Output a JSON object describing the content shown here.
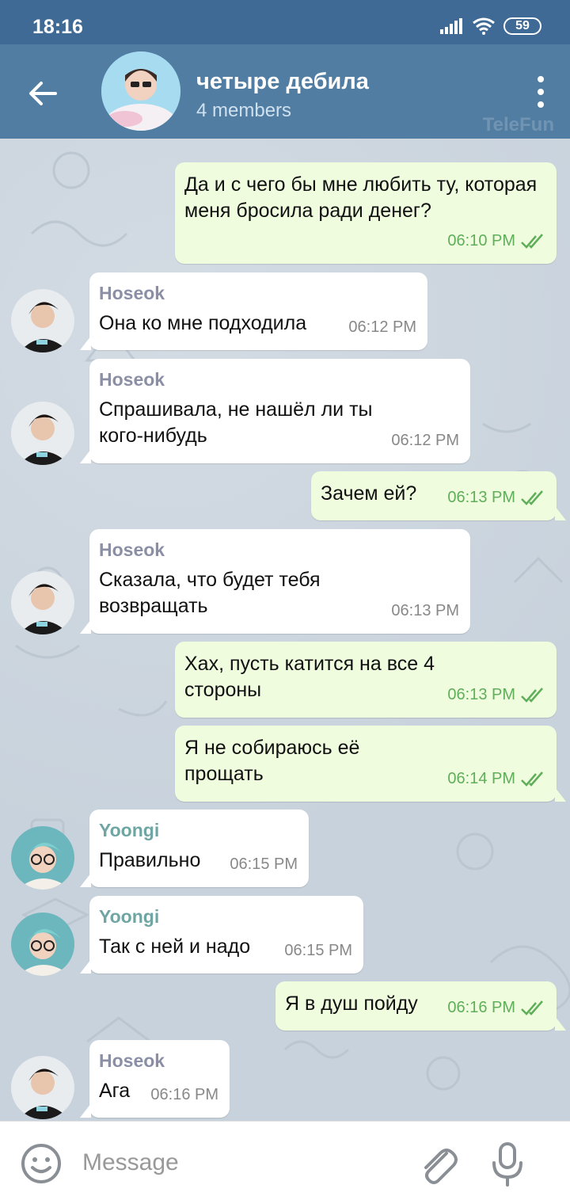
{
  "status_bar": {
    "time": "18:16",
    "battery": "59",
    "icons": [
      "signal-icon",
      "wifi-icon",
      "battery-icon"
    ]
  },
  "header": {
    "title": "четыре дебила",
    "subtitle": "4 members",
    "watermark": "TeleFun",
    "icons": [
      "back-arrow-icon",
      "more-vertical-icon"
    ]
  },
  "colors": {
    "header": "#517da2",
    "status_bar": "#3f6a95",
    "outgoing_bubble": "#effdde",
    "incoming_bubble": "#ffffff",
    "hoseok_name": "#8a8fa6",
    "yoongi_name": "#6fa5a3",
    "read_ticks": "#5fae5a"
  },
  "messages": [
    {
      "direction": "out",
      "text": "Да и с чего бы мне любить ту, которая меня бросила ради денег?",
      "time": "06:10 PM",
      "read": true
    },
    {
      "direction": "in",
      "sender": "Hoseok",
      "text": "Она ко мне подходила",
      "time": "06:12 PM"
    },
    {
      "direction": "in",
      "sender": "Hoseok",
      "text": "Спрашивала, не нашёл ли ты кого-нибудь",
      "time": "06:12 PM"
    },
    {
      "direction": "out",
      "text": "Зачем ей?",
      "time": "06:13 PM",
      "read": true
    },
    {
      "direction": "in",
      "sender": "Hoseok",
      "text": "Сказала, что будет тебя возвращать",
      "time": "06:13 PM"
    },
    {
      "direction": "out",
      "text": "Хах, пусть катится на все 4 стороны",
      "time": "06:13 PM",
      "read": true
    },
    {
      "direction": "out",
      "text": "Я не собираюсь её прощать",
      "time": "06:14 PM",
      "read": true
    },
    {
      "direction": "in",
      "sender": "Yoongi",
      "text": "Правильно",
      "time": "06:15 PM"
    },
    {
      "direction": "in",
      "sender": "Yoongi",
      "text": "Так с ней и надо",
      "time": "06:15 PM"
    },
    {
      "direction": "out",
      "text": "Я в душ пойду",
      "time": "06:16 PM",
      "read": true
    },
    {
      "direction": "in",
      "sender": "Hoseok",
      "text": "Ага",
      "time": "06:16 PM"
    }
  ],
  "input": {
    "placeholder": "Message",
    "icons": [
      "emoji-icon",
      "attach-icon",
      "mic-icon"
    ]
  }
}
